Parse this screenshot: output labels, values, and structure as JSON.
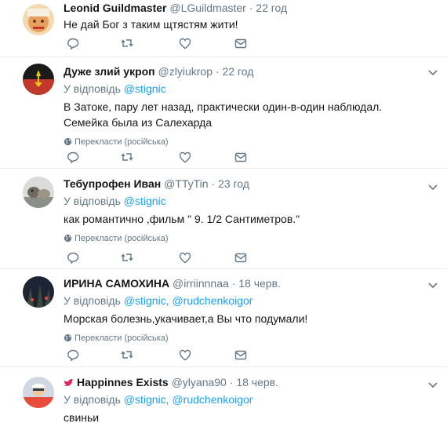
{
  "icons": {
    "reply": "reply-icon",
    "retweet": "retweet-icon",
    "like": "heart-icon",
    "dm": "envelope-icon",
    "more": "chevron-down-icon",
    "translate": "globe-icon"
  },
  "colors": {
    "accent": "#1da1f2",
    "muted": "#657786",
    "border": "#e6ecf0"
  },
  "tweets": [
    {
      "fullname": "Leonid Guildmaster",
      "username": "@LGuildmaster",
      "sep": "·",
      "time": "22 год",
      "text": "Не дай Бог з таким щтястям жити!"
    },
    {
      "fullname": "Дуже злий укроп",
      "username": "@zlyiukrop",
      "sep": "·",
      "time": "22 год",
      "reply_prefix": "У відповідь",
      "mention1": "@stignic",
      "text": "В Затоке, пару лет назад, практически один-в-один наблюдал. Семейка была из Салехарда",
      "translate": "Перекласти (російська)"
    },
    {
      "fullname": "Тебупрофен Иван",
      "username": "@TTyTin",
      "sep": "·",
      "time": "23 год",
      "reply_prefix": "У відповідь",
      "mention1": "@stignic",
      "text": "как романтично ,фильм \" 9. 1/2 Сантиметров.\"",
      "translate": "Перекласти (російська)"
    },
    {
      "fullname": "ИРИНА САМОХИНА",
      "username": "@irriinnnaa",
      "sep": "·",
      "time": "18 черв.",
      "reply_prefix": "У відповідь",
      "mention1": "@stignic,",
      "mention2": "@rudchenkoigor",
      "text": "Морская болезнь,укачивает,а Вы что подумали!",
      "translate": "Перекласти (російська)"
    },
    {
      "fullname": "Happinnes Exists",
      "username": "@ylyana90",
      "sep": "·",
      "time": "18 черв.",
      "reply_prefix": "У відповідь",
      "mention1": "@stignic,",
      "mention2": "@rudchenkoigor",
      "text": "свиньи"
    }
  ]
}
